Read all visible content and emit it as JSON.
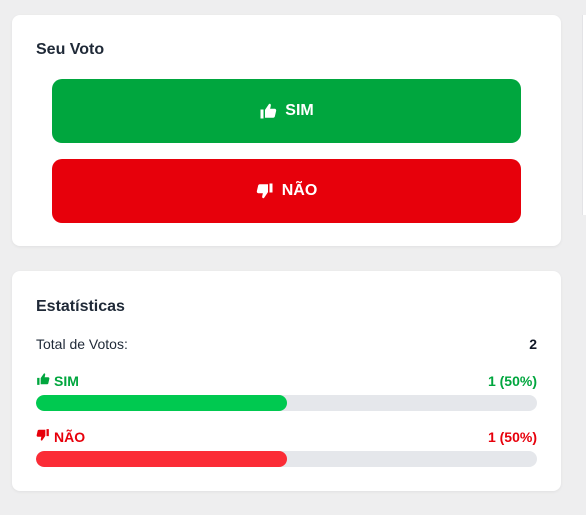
{
  "vote_card": {
    "title": "Seu Voto",
    "yes_label": "SIM",
    "no_label": "NÃO",
    "yes_icon": "thumbs-up-icon",
    "no_icon": "thumbs-down-icon"
  },
  "stats_card": {
    "title": "Estatísticas",
    "total_label": "Total de Votos:",
    "total_value": "2",
    "yes": {
      "label": "SIM",
      "count_text": "1 (50%)",
      "percent": 50
    },
    "no": {
      "label": "NÃO",
      "count_text": "1 (50%)",
      "percent": 50
    }
  },
  "colors": {
    "yes_button": "#00a63e",
    "no_button": "#e7000b",
    "yes_bar": "#00c950",
    "no_bar": "#fb2c36",
    "track": "#e5e7eb"
  }
}
